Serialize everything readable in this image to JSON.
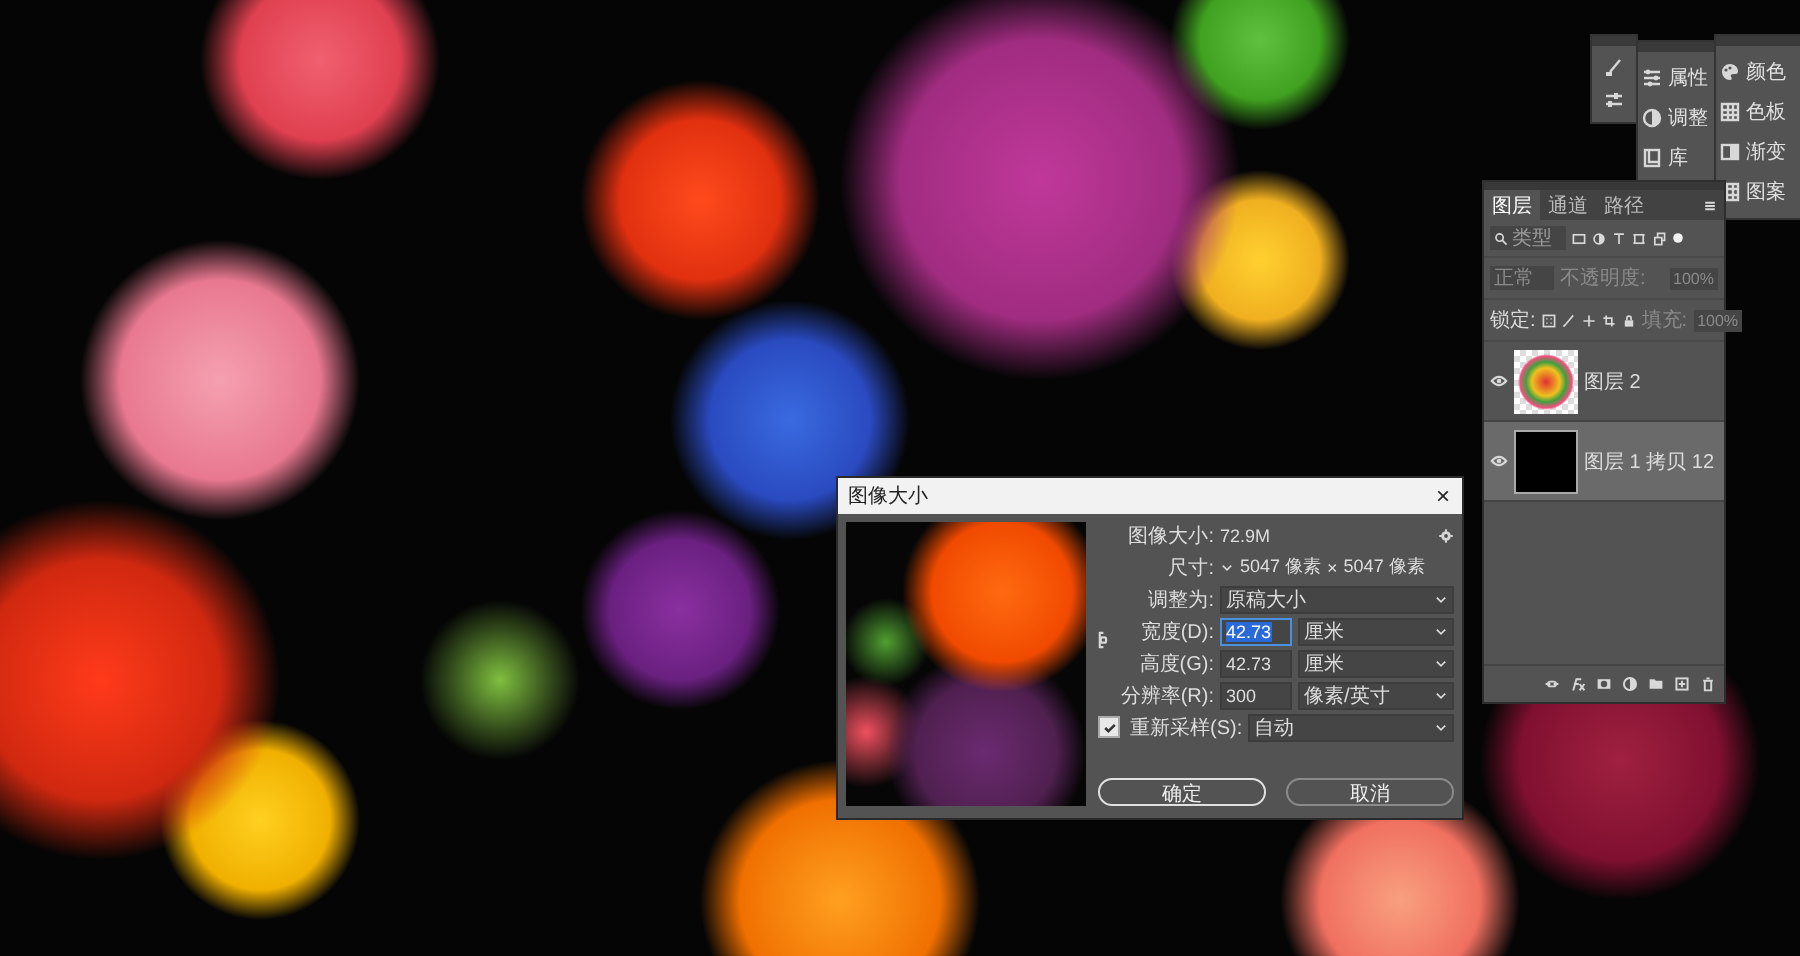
{
  "mini_panels": [
    {
      "items": [
        {
          "label": "属性"
        },
        {
          "label": "调整"
        },
        {
          "label": "库"
        }
      ]
    },
    {
      "items": [
        {
          "label": "颜色"
        },
        {
          "label": "色板"
        },
        {
          "label": "渐变"
        },
        {
          "label": "图案"
        }
      ]
    }
  ],
  "layers_panel": {
    "tabs": [
      {
        "label": "图层",
        "selected": true
      },
      {
        "label": "通道",
        "selected": false
      },
      {
        "label": "路径",
        "selected": false
      }
    ],
    "search": {
      "placeholder": "类型"
    },
    "blend_mode": {
      "value": "正常",
      "disabled": true
    },
    "opacity": {
      "label": "不透明度:",
      "value": "100%",
      "disabled": true
    },
    "lock_label": "锁定:",
    "fill": {
      "label": "填充:",
      "value": "100%",
      "disabled": true
    },
    "layers": [
      {
        "name": "图层 2",
        "kind": "pattern",
        "visible": true,
        "selected": false
      },
      {
        "name": "图层 1 拷贝 12",
        "kind": "solid",
        "visible": true,
        "selected": true
      }
    ]
  },
  "dialog": {
    "title": "图像大小",
    "close": "×",
    "image_size": {
      "label": "图像大小:",
      "value": "72.9M"
    },
    "dimensions": {
      "label": "尺寸:",
      "width": "5047 像素",
      "times": "×",
      "height": "5047 像素"
    },
    "fit_to": {
      "label": "调整为:",
      "value": "原稿大小"
    },
    "size_linked": true,
    "fields": [
      {
        "label": "宽度(D):",
        "value": "42.73",
        "unit": "厘米",
        "focused": true
      },
      {
        "label": "高度(G):",
        "value": "42.73",
        "unit": "厘米",
        "focused": false
      },
      {
        "label": "分辨率(R):",
        "value": "300",
        "unit": "像素/英寸",
        "focused": false
      }
    ],
    "resample": {
      "label": "重新采样(S):",
      "checked": true,
      "value": "自动"
    },
    "buttons": [
      {
        "label": "确定",
        "primary": true
      },
      {
        "label": "取消",
        "primary": false
      }
    ]
  }
}
